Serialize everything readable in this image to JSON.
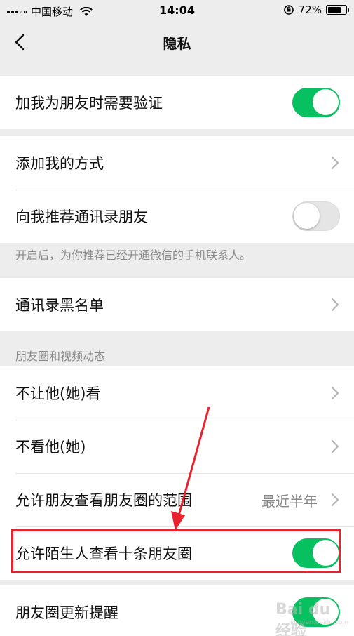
{
  "status_bar": {
    "carrier": "中国移动",
    "time": "14:04",
    "battery": "72%",
    "battery_level": 0.72
  },
  "nav": {
    "title": "隐私"
  },
  "section1": {
    "verify_label": "加我为朋友时需要验证",
    "verify_on": true
  },
  "section2": {
    "add_method_label": "添加我的方式",
    "recommend_label": "向我推荐通讯录朋友",
    "recommend_on": false,
    "recommend_hint": "开启后，为你推荐已经开通微信的手机联系人。"
  },
  "section3": {
    "blacklist_label": "通讯录黑名单"
  },
  "moments": {
    "header": "朋友圈和视频动态",
    "hide_from_label": "不让他(她)看",
    "dont_see_label": "不看他(她)",
    "range_label": "允许朋友查看朋友圈的范围",
    "range_value": "最近半年",
    "stranger_label": "允许陌生人查看十条朋友圈",
    "stranger_on": true
  },
  "section5": {
    "update_reminder_label": "朋友圈更新提醒",
    "update_reminder_on": true
  },
  "watermark": {
    "main": "Bai du 经验",
    "sub": "jingyan.baidu.com"
  },
  "colors": {
    "accent": "#07c160",
    "highlight": "#e8232d",
    "background": "#ededed"
  }
}
